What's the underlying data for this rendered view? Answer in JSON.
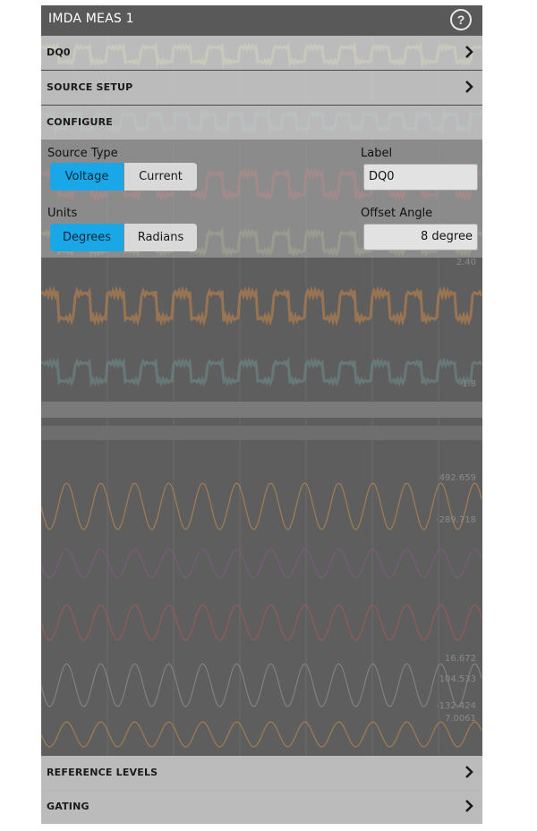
{
  "panel": {
    "title": "IMDA MEAS 1",
    "help_icon": "question-circle-icon"
  },
  "sections": {
    "dq0": "DQ0",
    "source_setup": "SOURCE SETUP",
    "configure": "CONFIGURE",
    "reference_levels": "REFERENCE LEVELS",
    "gating": "GATING"
  },
  "configure": {
    "source_type_label": "Source Type",
    "source_type_options": [
      "Voltage",
      "Current"
    ],
    "source_type_selected": "Voltage",
    "label_label": "Label",
    "label_value": "DQ0",
    "units_label": "Units",
    "units_options": [
      "Degrees",
      "Radians"
    ],
    "units_selected": "Degrees",
    "offset_angle_label": "Offset Angle",
    "offset_angle_value": "8 degree"
  },
  "background_readouts": {
    "r1": "2.40",
    "r2": "-1.8",
    "r3": "492.659",
    "r4": "-289.718",
    "r5": "16.672",
    "r6": "104.533",
    "r7": "-132.424",
    "r8": "7.0061"
  },
  "colors": {
    "accent_selected": "#1aa7e8",
    "title_bar": "#595959"
  }
}
